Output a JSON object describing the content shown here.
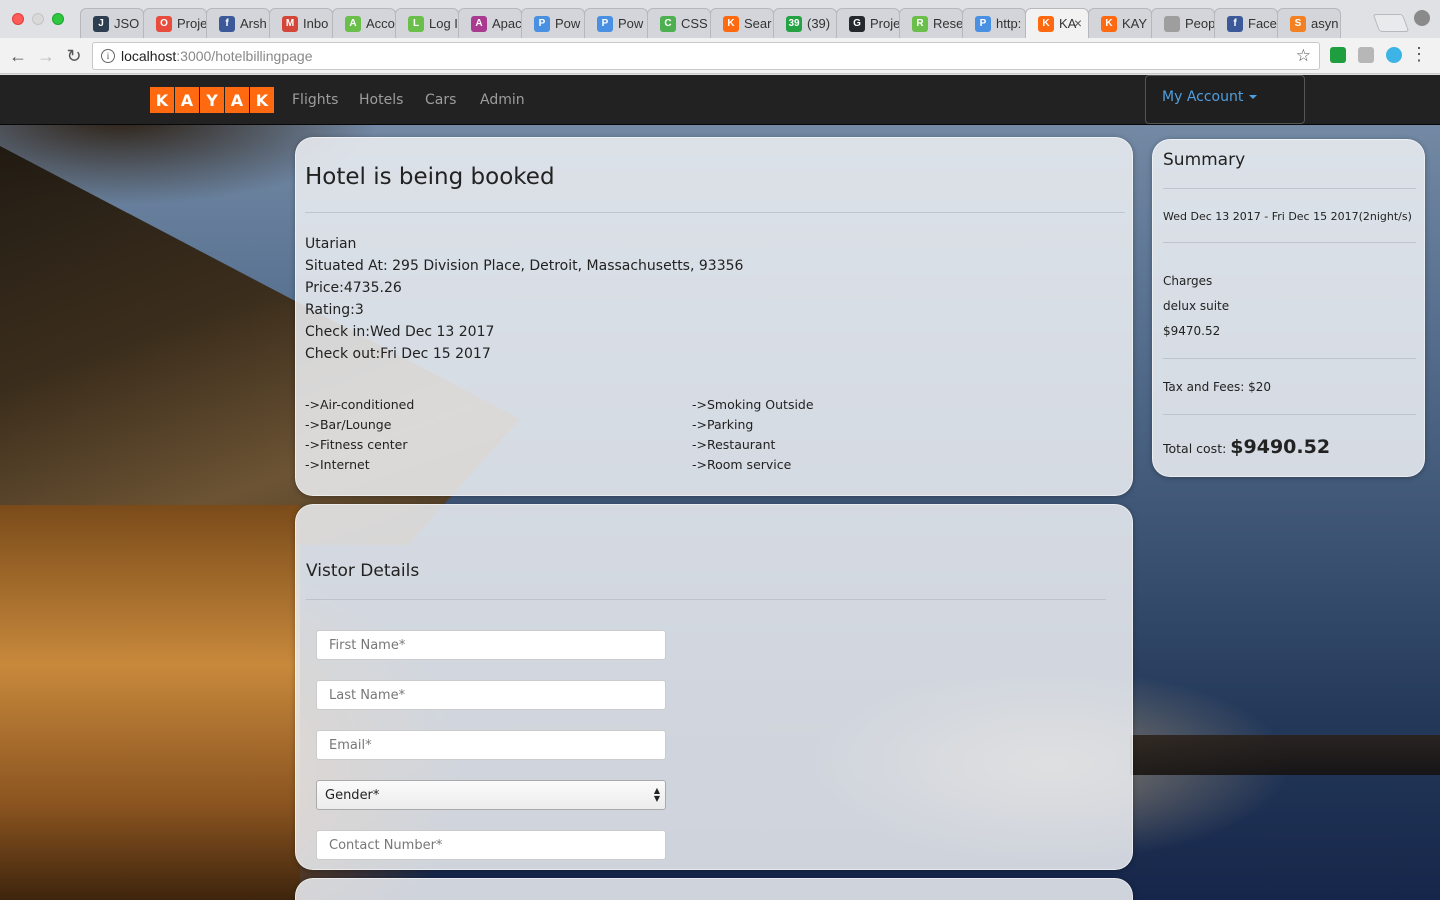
{
  "browser": {
    "tabs": [
      {
        "label": "JSO",
        "fav_color": "#2c3e50",
        "fav_text": "J"
      },
      {
        "label": "Proje",
        "fav_color": "#e74c3c",
        "fav_text": "O"
      },
      {
        "label": "Arsh",
        "fav_color": "#3b5998",
        "fav_text": "f"
      },
      {
        "label": "Inbo",
        "fav_color": "#d44638",
        "fav_text": "M"
      },
      {
        "label": "Acco",
        "fav_color": "#6abf4b",
        "fav_text": "A"
      },
      {
        "label": "Log I",
        "fav_color": "#6abf4b",
        "fav_text": "L"
      },
      {
        "label": "Apac",
        "fav_color": "#a83a8f",
        "fav_text": "A"
      },
      {
        "label": "Pow",
        "fav_color": "#4a90e2",
        "fav_text": "P"
      },
      {
        "label": "Pow",
        "fav_color": "#4a90e2",
        "fav_text": "P"
      },
      {
        "label": "CSS",
        "fav_color": "#4caf50",
        "fav_text": "C"
      },
      {
        "label": "Sear",
        "fav_color": "#ff690f",
        "fav_text": "K"
      },
      {
        "label": "(39)",
        "fav_color": "#25a244",
        "fav_text": "39"
      },
      {
        "label": "Proje",
        "fav_color": "#24292e",
        "fav_text": "G"
      },
      {
        "label": "Rese",
        "fav_color": "#6abf4b",
        "fav_text": "R"
      },
      {
        "label": "http:",
        "fav_color": "#4a90e2",
        "fav_text": "P"
      },
      {
        "label": "KA",
        "fav_color": "#ff690f",
        "fav_text": "K"
      },
      {
        "label": "KAY",
        "fav_color": "#ff690f",
        "fav_text": "K"
      },
      {
        "label": "Peop",
        "fav_color": "#9e9e9e",
        "fav_text": ""
      },
      {
        "label": "Face",
        "fav_color": "#3b5998",
        "fav_text": "f"
      },
      {
        "label": "asyn",
        "fav_color": "#f48024",
        "fav_text": "S"
      }
    ],
    "active_tab_index": 15,
    "url_host": "localhost",
    "url_path": ":3000/hotelbillingpage"
  },
  "navbar": {
    "logo_letters": [
      "K",
      "A",
      "Y",
      "A",
      "K"
    ],
    "links": [
      "Flights",
      "Hotels",
      "Cars",
      "Admin"
    ],
    "account_label": "My Account"
  },
  "booking": {
    "title": "Hotel is being booked",
    "hotel_name": "Utarian",
    "address": "Situated At: 295 Division Place, Detroit, Massachusetts, 93356",
    "price": "Price:4735.26",
    "rating": "Rating:3",
    "check_in": "Check in:Wed Dec 13 2017",
    "check_out": "Check out:Fri Dec 15 2017",
    "amenities_left": [
      "->Air-conditioned",
      "->Bar/Lounge",
      "->Fitness center",
      "->Internet"
    ],
    "amenities_right": [
      "->Smoking Outside",
      "->Parking",
      "->Restaurant",
      "->Room service"
    ]
  },
  "summary": {
    "title": "Summary",
    "dates": "Wed Dec 13 2017 - Fri Dec 15 2017(2night/s)",
    "charges_label": "Charges",
    "room_type": "delux suite",
    "charges_amount": "$9470.52",
    "tax_fees": "Tax and Fees: $20",
    "total_label": "Total cost: ",
    "total_value": "$9490.52"
  },
  "visitor": {
    "title": "Vistor Details",
    "first_name_placeholder": "First Name*",
    "last_name_placeholder": "Last Name*",
    "email_placeholder": "Email*",
    "gender_selected": "Gender*",
    "contact_placeholder": "Contact Number*"
  },
  "colors": {
    "brand": "#ff690f",
    "navbar_bg": "#222222",
    "account_link": "#4f9fe0"
  }
}
